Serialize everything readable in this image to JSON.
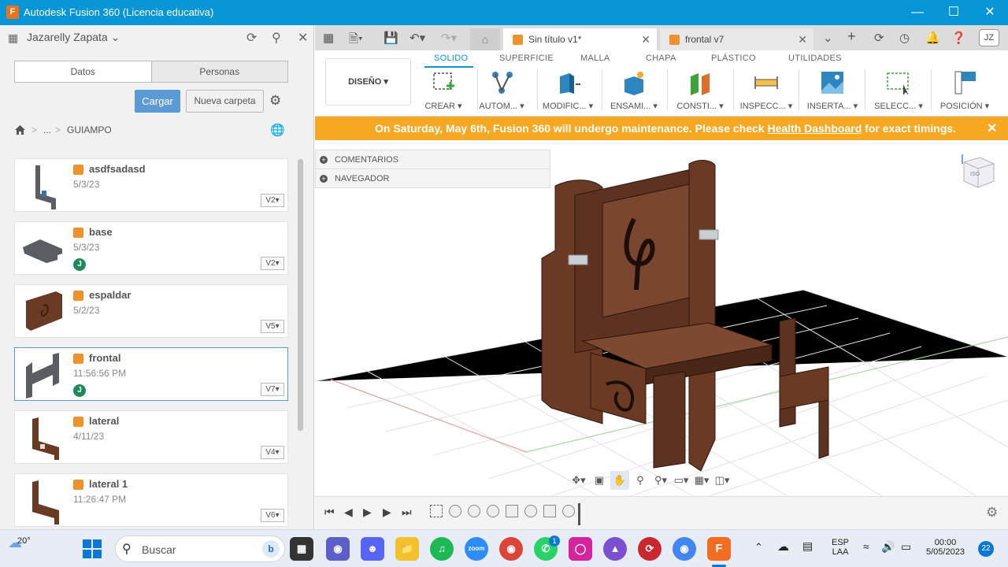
{
  "window": {
    "title": "Autodesk Fusion 360 (Licencia educativa)",
    "app_icon": "F",
    "controls": [
      "minimize",
      "maximize",
      "close"
    ]
  },
  "left_panel": {
    "user": "Jazarelly Zapata",
    "tabs": [
      "Datos",
      "Personas"
    ],
    "upload_label": "Cargar",
    "new_folder_label": "Nueva carpeta",
    "breadcrumb": {
      "ellipsis": "...",
      "current": "GUIAMPO"
    },
    "files": [
      {
        "name": "asdfsadasd",
        "date": "5/3/23",
        "version": "V2",
        "avatar": ""
      },
      {
        "name": "base",
        "date": "5/3/23",
        "version": "V2",
        "avatar": "J"
      },
      {
        "name": "espaldar",
        "date": "5/2/23",
        "version": "V5",
        "avatar": ""
      },
      {
        "name": "frontal",
        "date": "11:56:56 PM",
        "version": "V7",
        "avatar": "J"
      },
      {
        "name": "lateral",
        "date": "4/11/23",
        "version": "V4",
        "avatar": ""
      },
      {
        "name": "lateral 1",
        "date": "11:26:47 PM",
        "version": "V6",
        "avatar": ""
      }
    ]
  },
  "doc_tabs": [
    {
      "label": "Sin título v1*",
      "active": true
    },
    {
      "label": "frontal v7",
      "active": false
    }
  ],
  "user_initials": "JZ",
  "ribbon": {
    "tabs": [
      "SOLIDO",
      "SUPERFICIE",
      "MALLA",
      "CHAPA",
      "PLÁSTICO",
      "UTILIDADES"
    ],
    "active_tab": "SOLIDO",
    "workspace": "DISEÑO",
    "groups": [
      "CREAR",
      "AUTOM...",
      "MODIFIC...",
      "ENSAMI...",
      "CONSTI...",
      "INSPECC...",
      "INSERTA...",
      "SELECC...",
      "POSICIÓN"
    ]
  },
  "banner": {
    "text_before": "On Saturday, May 6th, Fusion 360 will undergo maintenance. Please check ",
    "link": "Health Dashboard",
    "text_after": " for exact timings."
  },
  "browser": {
    "rows": [
      "COMENTARIOS",
      "NAVEGADOR"
    ]
  },
  "viewcube_label": "ISO",
  "taskbar": {
    "weather": "20°",
    "search_placeholder": "Buscar",
    "whatsapp_badge": "1",
    "language": "ESP",
    "layout": "LAA",
    "time": "00:00",
    "date": "5/05/2023",
    "notifications": "22"
  },
  "colors": {
    "accent": "#0696d7",
    "banner": "#f7a823",
    "wood": "#6b3a24",
    "cube": "#f0922b"
  }
}
